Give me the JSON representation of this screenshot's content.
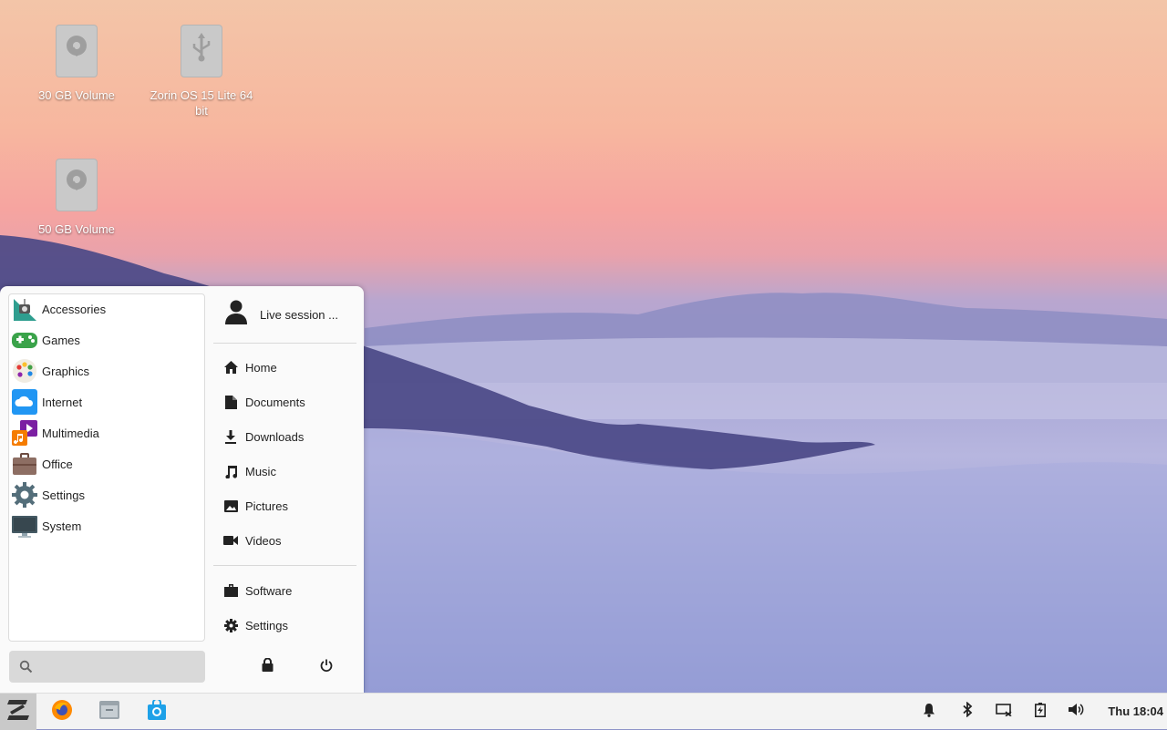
{
  "desktop": {
    "icons": [
      {
        "label": "30 GB Volume",
        "type": "drive-icon"
      },
      {
        "label": "Zorin OS 15 Lite 64 bit",
        "type": "usb-drive-icon"
      },
      {
        "label": "50 GB Volume",
        "type": "drive-icon"
      }
    ]
  },
  "menu": {
    "categories": [
      {
        "label": "Accessories",
        "icon": "accessories-icon"
      },
      {
        "label": "Games",
        "icon": "gamepad-icon"
      },
      {
        "label": "Graphics",
        "icon": "palette-icon"
      },
      {
        "label": "Internet",
        "icon": "cloud-icon"
      },
      {
        "label": "Multimedia",
        "icon": "multimedia-icon"
      },
      {
        "label": "Office",
        "icon": "briefcase-icon"
      },
      {
        "label": "Settings",
        "icon": "gear-icon"
      },
      {
        "label": "System",
        "icon": "monitor-icon"
      }
    ],
    "user": {
      "label": "Live session ..."
    },
    "places": [
      {
        "label": "Home",
        "icon": "home-icon"
      },
      {
        "label": "Documents",
        "icon": "document-icon"
      },
      {
        "label": "Downloads",
        "icon": "download-icon"
      },
      {
        "label": "Music",
        "icon": "music-icon"
      },
      {
        "label": "Pictures",
        "icon": "picture-icon"
      },
      {
        "label": "Videos",
        "icon": "video-icon"
      }
    ],
    "apps": [
      {
        "label": "Software",
        "icon": "software-icon"
      },
      {
        "label": "Settings",
        "icon": "gear-icon"
      }
    ],
    "search": {
      "placeholder": ""
    }
  },
  "taskbar": {
    "clock": "Thu 18:04",
    "apps": [
      "zorin-menu-icon",
      "firefox-icon",
      "files-icon",
      "software-store-icon"
    ],
    "tray": [
      "bell-icon",
      "bluetooth-icon",
      "display-icon",
      "battery-icon",
      "volume-icon"
    ]
  }
}
